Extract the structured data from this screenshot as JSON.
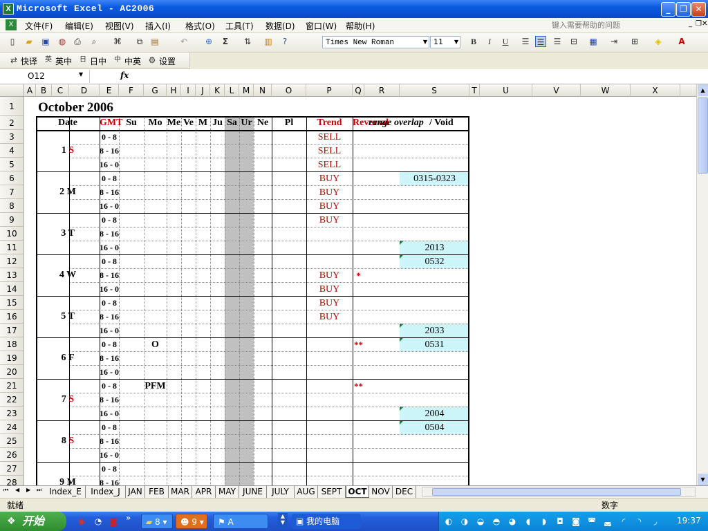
{
  "window": {
    "title": "Microsoft Excel - AC2006"
  },
  "menu": [
    "文件(F)",
    "编辑(E)",
    "视图(V)",
    "插入(I)",
    "格式(O)",
    "工具(T)",
    "数据(D)",
    "窗口(W)",
    "帮助(H)"
  ],
  "help_placeholder": "键入需要帮助的问题",
  "toolbar": {
    "font": "Times New Roman",
    "size": "11",
    "bold": "B",
    "italic": "I",
    "underline": "U"
  },
  "toolbar2": [
    "快译",
    "英中",
    "日中",
    "中英",
    "设置"
  ],
  "namebox": "O12",
  "fx": "fx",
  "columns": [
    "A",
    "B",
    "C",
    "D",
    "E",
    "F",
    "G",
    "H",
    "I",
    "J",
    "K",
    "L",
    "M",
    "N",
    "O",
    "P",
    "Q",
    "R",
    "S",
    "T",
    "U",
    "V",
    "W",
    "X"
  ],
  "sheet_title": "October 2006",
  "headers": {
    "date": "Date",
    "gmt": "GMT",
    "su": "Su",
    "mo": "Mo",
    "me": "Me",
    "ve": "Ve",
    "ma": "M",
    "ju": "Ju",
    "sa": "Sa",
    "ur": "Ur",
    "ne": "Ne",
    "pl": "Pl",
    "trend": "Trend",
    "reversal": "Reversal",
    "range": "range overlap",
    "void": " / Void"
  },
  "row_numbers": [
    1,
    2,
    3,
    4,
    5,
    6,
    7,
    8,
    9,
    10,
    11,
    12,
    13,
    14,
    15,
    16,
    17,
    18,
    19,
    20,
    21,
    22,
    23,
    24,
    25,
    26,
    27,
    28
  ],
  "days": [
    {
      "num": "1",
      "dow": "S",
      "red": true
    },
    {
      "num": "2",
      "dow": "M",
      "red": false
    },
    {
      "num": "3",
      "dow": "T",
      "red": false
    },
    {
      "num": "4",
      "dow": "W",
      "red": false
    },
    {
      "num": "5",
      "dow": "T",
      "red": false
    },
    {
      "num": "6",
      "dow": "F",
      "red": false
    },
    {
      "num": "7",
      "dow": "S",
      "red": true
    },
    {
      "num": "8",
      "dow": "S",
      "red": true
    },
    {
      "num": "9",
      "dow": "M",
      "red": false
    }
  ],
  "slots": [
    "0 - 8",
    "8 - 16",
    "16 - 0",
    "0 - 8",
    "8 - 16",
    "16 - 0",
    "0 - 8",
    "8 - 16",
    "16 - 0",
    "0 - 8",
    "8 - 16",
    "16 - 0",
    "0 - 8",
    "8 - 16",
    "16 - 0",
    "0 - 8",
    "8 - 16",
    "16 - 0",
    "0 - 8",
    "8 - 16",
    "16 - 0",
    "0 - 8",
    "8 - 16",
    "16 - 0",
    "0 - 8",
    "8 - 16"
  ],
  "trend": [
    "SELL",
    "SELL",
    "SELL",
    "BUY",
    "BUY",
    "BUY",
    "BUY",
    "",
    "",
    "",
    "BUY",
    "BUY",
    "BUY",
    "BUY",
    "",
    "",
    "",
    "",
    "",
    "",
    "",
    "",
    "",
    "",
    "",
    ""
  ],
  "reversal": [
    "",
    "",
    "",
    "",
    "",
    "",
    "",
    "",
    "",
    "",
    "*",
    "",
    "",
    "",
    "",
    "**",
    "",
    "",
    "**",
    "",
    "",
    "",
    "",
    "",
    "",
    ""
  ],
  "mo": [
    "",
    "",
    "",
    "",
    "",
    "",
    "",
    "",
    "",
    "",
    "",
    "",
    "",
    "",
    "",
    "O",
    "",
    "",
    "PFM",
    "",
    "",
    "",
    "",
    "",
    "",
    ""
  ],
  "void": [
    "",
    "",
    "",
    "0315-0323",
    "",
    "",
    "",
    "",
    "2013",
    "0532",
    "",
    "",
    "",
    "",
    "2033",
    "0531",
    "",
    "",
    "",
    "",
    "2004",
    "0504",
    "",
    "",
    "",
    ""
  ],
  "tabs": [
    "Index_E",
    "Index_J",
    "JAN",
    "FEB",
    "MAR",
    "APR",
    "MAY",
    "JUNE",
    "JULY",
    "AUG",
    "SEPT",
    "OCT",
    "NOV",
    "DEC"
  ],
  "active_tab": "OCT",
  "status": {
    "left": "就绪",
    "right": "数字"
  },
  "taskbar": {
    "start": "开始",
    "folder": "8",
    "qq": "9",
    "ime": "A",
    "mypc": "我的电脑",
    "clock": "19:37"
  },
  "colors": {
    "accent_red": "#cc0000",
    "void_fill": "#ccf5f9",
    "shade": "#c0c0c0"
  }
}
